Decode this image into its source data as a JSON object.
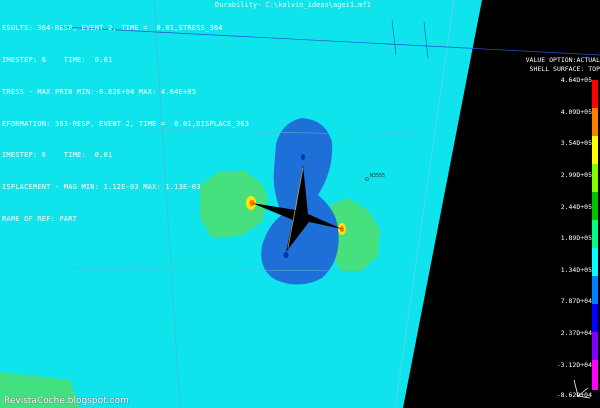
{
  "window": {
    "title": "Durability- C:\\kalvin_ideas\\agei1.mf1"
  },
  "hud": {
    "lines": [
      "ESULTS: 364-RESP, EVENT 2, TIME =  0.01,STRESS_364",
      "IMESTEP: 6    TIME:  0.01",
      "TRESS - MAX PRIN MIN:-8.82E+04 MAX: 4.64E+05",
      "EFORMATION: 363-RESP, EVENT 2, TIME =  0.01,DISPLACE_363",
      "IMESTEP: 6    TIME:  0.01",
      "ISPLACEMENT - MAG MIN: 1.12E-03 MAX: 1.13E-03",
      "RAME OF REF: PART"
    ]
  },
  "legend_panel": {
    "header_line1": "VALUE OPTION:ACTUAL",
    "header_line2": "SHELL SURFACE: TOP",
    "ticks": [
      "4.64D+05",
      "4.09D+05",
      "3.54D+05",
      "2.99D+05",
      "2.44D+05",
      "1.89D+05",
      "1.34D+05",
      "7.87D+04",
      "2.37D+04",
      "-3.12D+04",
      "-8.62D+04"
    ],
    "colors": [
      "#ff0000",
      "#ff7f00",
      "#ffff00",
      "#7fff00",
      "#00c000",
      "#00ff80",
      "#00ffff",
      "#0080ff",
      "#0000ff",
      "#8000ff",
      "#ff00ff"
    ]
  },
  "node_label": "N3555",
  "watermark": "RevistaCoche.blogspot.com",
  "colors": {
    "background": "#000000",
    "plate_cyan": "#0fe3ec",
    "blue_region": "#1e70d8",
    "green_region": "#47e07f",
    "crack": "#000000"
  }
}
